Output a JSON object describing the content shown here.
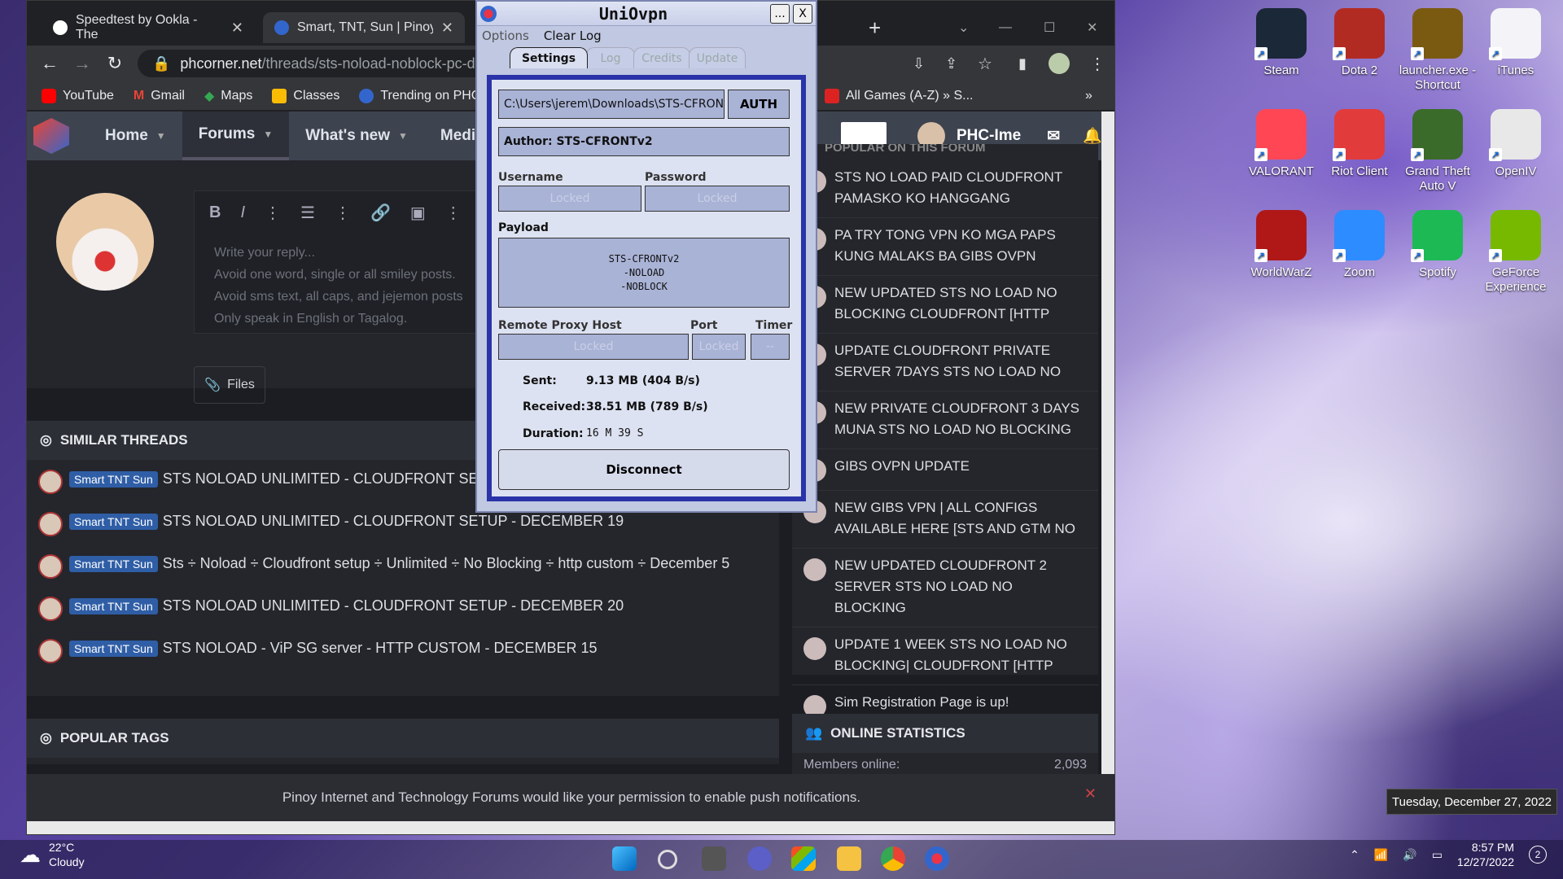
{
  "browser": {
    "tabs": [
      {
        "label": "Speedtest by Ookla - The"
      },
      {
        "label": "Smart, TNT, Sun | Pinoy In"
      }
    ],
    "url_host": "phcorner.net",
    "url_path": "/threads/sts-noload-noblock-pc-de",
    "bookmarks": [
      {
        "label": "YouTube"
      },
      {
        "label": "Gmail"
      },
      {
        "label": "Maps"
      },
      {
        "label": "Classes"
      },
      {
        "label": "Trending on PHCo"
      },
      {
        "label": "All Games (A-Z) » S..."
      }
    ],
    "bookmarks_more": "»"
  },
  "site": {
    "nav": [
      {
        "label": "Home"
      },
      {
        "label": "Forums"
      },
      {
        "label": "What's new"
      },
      {
        "label": "Media"
      }
    ],
    "username": "PHC-Ime",
    "placeholder_lines": [
      "Write your reply...",
      "Avoid one word, single or all smiley posts.",
      "Avoid sms text, all caps, and jejemon posts",
      "Only speak in English or Tagalog."
    ],
    "files_label": "Files",
    "similar_title": "SIMILAR THREADS",
    "threads": [
      {
        "badge": "Smart TNT Sun",
        "title": "STS NOLOAD UNLIMITED - CLOUDFRONT SETUP"
      },
      {
        "badge": "Smart TNT Sun",
        "title": "STS NOLOAD UNLIMITED - CLOUDFRONT SETUP - DECEMBER 19"
      },
      {
        "badge": "Smart TNT Sun",
        "title": "Sts ÷ Noload ÷ Cloudfront setup ÷ Unlimited ÷ No Blocking ÷ http custom ÷ December 5"
      },
      {
        "badge": "Smart TNT Sun",
        "title": "STS NOLOAD UNLIMITED - CLOUDFRONT SETUP - DECEMBER 20"
      },
      {
        "badge": "Smart TNT Sun",
        "title": "STS NOLOAD - ViP SG server - HTTP CUSTOM - DECEMBER 15"
      }
    ],
    "popular_tags_title": "POPULAR TAGS",
    "popular_title": "POPULAR ON THIS FORUM",
    "popular": [
      {
        "title": "STS NO LOAD PAID CLOUDFRONT PAMASKO KO HANGGANG"
      },
      {
        "title": "PA TRY TONG VPN KO MGA PAPS KUNG MALAKS BA GIBS OVPN"
      },
      {
        "title": "NEW UPDATED STS NO LOAD NO BLOCKING CLOUDFRONT [HTTP"
      },
      {
        "title": "UPDATE CLOUDFRONT PRIVATE SERVER 7DAYS STS NO LOAD NO"
      },
      {
        "title": "NEW PRIVATE CLOUDFRONT 3 DAYS MUNA STS NO LOAD NO BLOCKING"
      },
      {
        "title": "GIBS OVPN UPDATE"
      },
      {
        "title": "NEW GIBS VPN | ALL CONFIGS AVAILABLE HERE [STS AND GTM NO"
      },
      {
        "title": "NEW UPDATED CLOUDFRONT 2 SERVER STS NO LOAD NO BLOCKING"
      },
      {
        "title": "UPDATE 1 WEEK STS NO LOAD NO BLOCKING| CLOUDFRONT [HTTP"
      },
      {
        "title": "Sim Registration Page is up!"
      }
    ],
    "online_title": "ONLINE STATISTICS",
    "members_online_label": "Members online:",
    "members_online_value": "2,093",
    "notification": "Pinoy Internet and Technology Forums would like your permission to enable push notifications."
  },
  "vpn": {
    "title": "UniOvpn",
    "minimize": "...",
    "close": "X",
    "menu": [
      "Options",
      "Clear Log"
    ],
    "tabs": [
      "Settings",
      "Log",
      "Credits",
      "Update"
    ],
    "config_path": "C:\\Users\\jerem\\Downloads\\STS-CFRONTv2",
    "auth_label": "AUTH",
    "author": "Author: STS-CFRONTv2",
    "username_label": "Username",
    "password_label": "Password",
    "locked": "Locked",
    "payload_label": "Payload",
    "payload_lines": [
      "STS-CFRONTv2",
      "-NOLOAD",
      "-NOBLOCK"
    ],
    "proxy_label": "Remote Proxy Host",
    "port_label": "Port",
    "timer_label": "Timer",
    "timer_value": "--",
    "sent_label": "Sent:",
    "sent_value": "9.13 MB (404 B/s)",
    "received_label": "Received:",
    "received_value": "38.51 MB (789 B/s)",
    "duration_label": "Duration:",
    "duration_value": "16 M 39 S",
    "disconnect_label": "Disconnect"
  },
  "desktop_icons": [
    {
      "label": "Steam",
      "icon": "steam-icon",
      "color": "#1b2838"
    },
    {
      "label": "Dota 2",
      "icon": "dota-icon",
      "color": "#b22b22"
    },
    {
      "label": "launcher.exe - Shortcut",
      "icon": "launcher-icon",
      "color": "#7a5a10"
    },
    {
      "label": "iTunes",
      "icon": "itunes-icon",
      "color": "#f4f4f8"
    },
    {
      "label": "VALORANT",
      "icon": "valorant-icon",
      "color": "#ff4655"
    },
    {
      "label": "Riot Client",
      "icon": "riot-icon",
      "color": "#e23b3b"
    },
    {
      "label": "Grand Theft Auto V",
      "icon": "gta-icon",
      "color": "#3a6b2a"
    },
    {
      "label": "OpenIV",
      "icon": "openiv-icon",
      "color": "#e8e8e8"
    },
    {
      "label": "WorldWarZ",
      "icon": "wwz-icon",
      "color": "#b01818"
    },
    {
      "label": "Zoom",
      "icon": "zoom-icon",
      "color": "#2d8cff"
    },
    {
      "label": "Spotify",
      "icon": "spotify-icon",
      "color": "#1db954"
    },
    {
      "label": "GeForce Experience",
      "icon": "geforce-icon",
      "color": "#76b900"
    }
  ],
  "taskbar": {
    "temp": "22°C",
    "condition": "Cloudy",
    "time": "8:57 PM",
    "date": "12/27/2022",
    "notif_count": "2",
    "tooltip": "Tuesday, December 27, 2022"
  }
}
